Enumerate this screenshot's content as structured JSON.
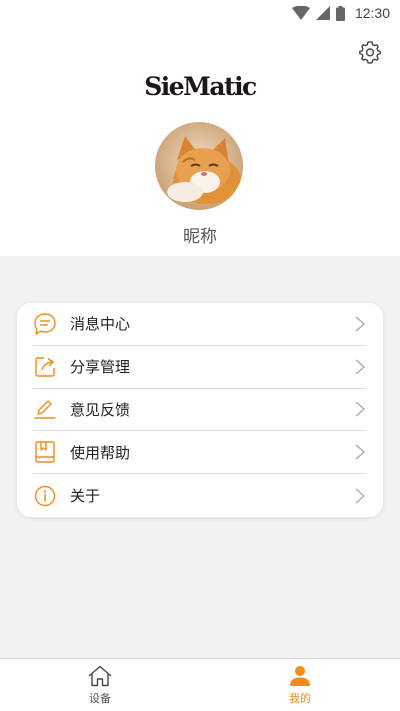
{
  "status_bar": {
    "time": "12:30"
  },
  "header": {
    "brand": "SieMatic",
    "nickname": "昵称"
  },
  "menu": [
    {
      "label": "消息中心",
      "icon": "message-icon"
    },
    {
      "label": "分享管理",
      "icon": "share-icon"
    },
    {
      "label": "意见反馈",
      "icon": "feedback-pencil-icon"
    },
    {
      "label": "使用帮助",
      "icon": "help-book-icon"
    },
    {
      "label": "关于",
      "icon": "info-icon"
    }
  ],
  "tabbar": {
    "tabs": [
      {
        "label": "设备",
        "icon": "home-icon",
        "active": false
      },
      {
        "label": "我的",
        "icon": "person-icon",
        "active": true
      }
    ]
  },
  "colors": {
    "accent": "#f08c1a",
    "background": "#f2f2f2"
  }
}
